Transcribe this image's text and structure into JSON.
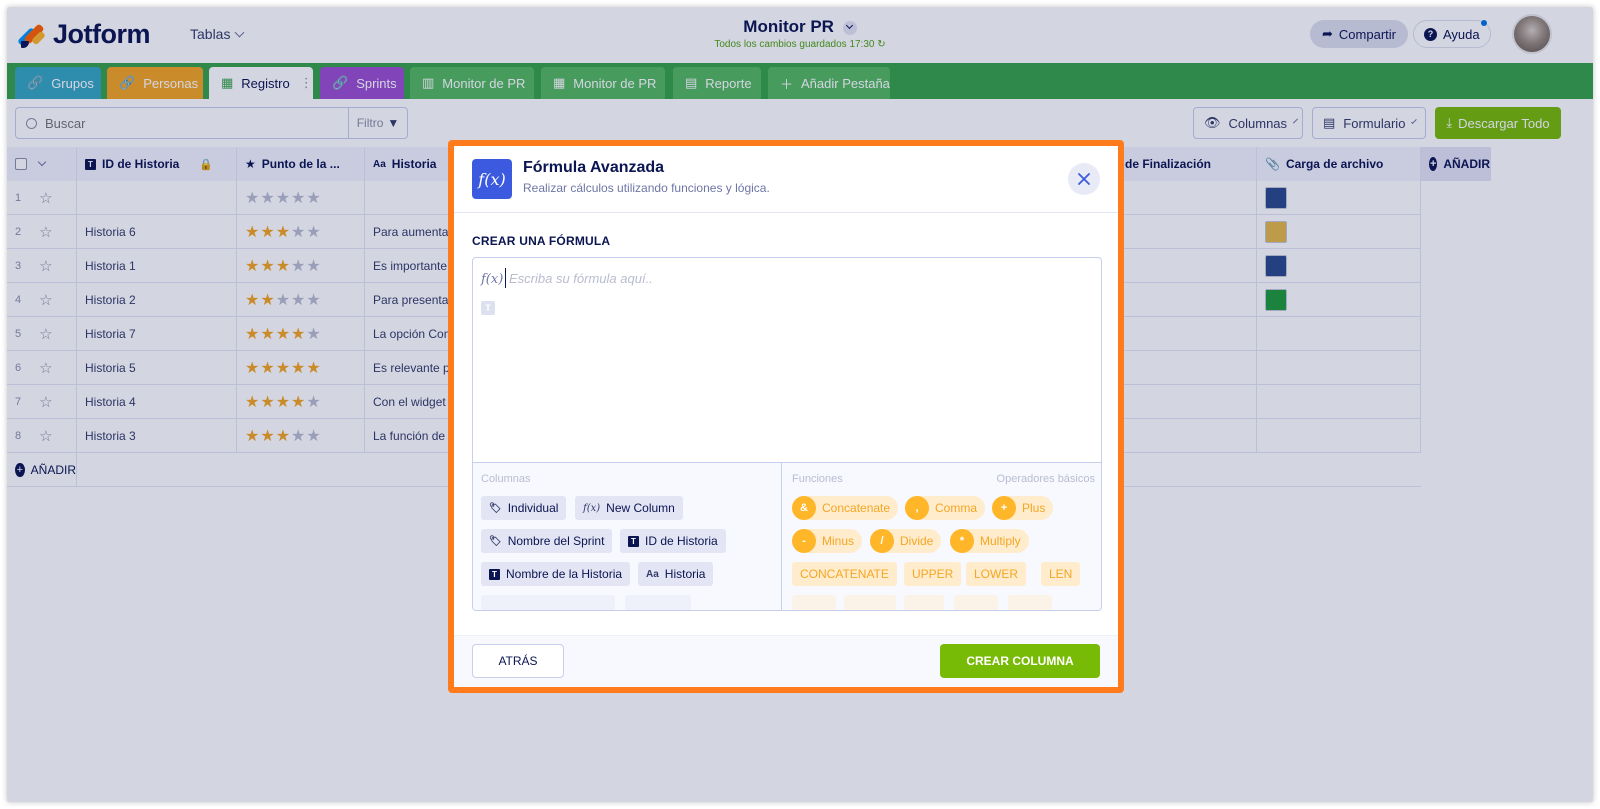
{
  "app": {
    "brand": "Jotform",
    "tables_menu": "Tablas",
    "title": "Monitor PR",
    "save_status": "Todos los cambios guardados 17:30",
    "share": "Compartir",
    "help": "Ayuda"
  },
  "tabs": [
    {
      "label": "Grupos",
      "color": "#36a6c0"
    },
    {
      "label": "Personas",
      "color": "#f5a623"
    },
    {
      "label": "Registro",
      "color": "#ffffff"
    },
    {
      "label": "Sprints",
      "color": "#9c4fd0"
    },
    {
      "label": "Monitor de PR",
      "color": "#55b960"
    },
    {
      "label": "Monitor de PR",
      "color": "#55b960"
    },
    {
      "label": "Reporte",
      "color": "#55b960"
    },
    {
      "label": "Añadir Pestaña",
      "color": "#55b960"
    }
  ],
  "toolbar": {
    "search_placeholder": "Buscar",
    "filter": "Filtro",
    "columns": "Columnas",
    "form": "Formulario",
    "download": "Descargar Todo"
  },
  "grid": {
    "headers": [
      "ID de Historia",
      "Punto de la ...",
      "Historia",
      "de Finalización",
      "Carga de archivo",
      "AÑADIR"
    ],
    "rows": [
      {
        "num": "1",
        "id": "",
        "stars": 0,
        "story": "",
        "swatch": "#2b4a8a"
      },
      {
        "num": "2",
        "id": "Historia 6",
        "stars": 3,
        "story": "Para aumentar",
        "swatch": "#e6b84a"
      },
      {
        "num": "3",
        "id": "Historia 1",
        "stars": 3,
        "story": "Es importante",
        "swatch": "#2b4a8a"
      },
      {
        "num": "4",
        "id": "Historia 2",
        "stars": 2,
        "story": "Para presentar",
        "swatch": "#1f9b3a"
      },
      {
        "num": "5",
        "id": "Historia 7",
        "stars": 4,
        "story": "La opción Com",
        "swatch": ""
      },
      {
        "num": "6",
        "id": "Historia 5",
        "stars": 5,
        "story": "Es relevante po",
        "swatch": ""
      },
      {
        "num": "7",
        "id": "Historia 4",
        "stars": 4,
        "story": "Con el widget d",
        "swatch": ""
      },
      {
        "num": "8",
        "id": "Historia 3",
        "stars": 3,
        "story": "La función de l",
        "swatch": ""
      }
    ],
    "add_row": "AÑADIR"
  },
  "modal": {
    "title": "Fórmula Avanzada",
    "subtitle": "Realizar cálculos utilizando funciones y lógica.",
    "section_label": "CREAR UNA FÓRMULA",
    "editor_placeholder": "Escriba su fórmula aquí..",
    "columns_label": "Columnas",
    "functions_label": "Funciones",
    "operators_label": "Operadores básicos",
    "column_chips": [
      {
        "icon": "tag-icon",
        "label": "Individual"
      },
      {
        "icon": "fx-icon",
        "label": "New Column"
      },
      {
        "icon": "tag-icon",
        "label": "Nombre del Sprint"
      },
      {
        "icon": "text-icon",
        "label": "ID de Historia"
      },
      {
        "icon": "text-icon",
        "label": "Nombre de la Historia"
      },
      {
        "icon": "aa-icon",
        "label": "Historia"
      }
    ],
    "operators": [
      {
        "symbol": "&",
        "label": "Concatenate"
      },
      {
        "symbol": ",",
        "label": "Comma"
      },
      {
        "symbol": "+",
        "label": "Plus"
      },
      {
        "symbol": "-",
        "label": "Minus"
      },
      {
        "symbol": "/",
        "label": "Divide"
      },
      {
        "symbol": "*",
        "label": "Multiply"
      }
    ],
    "functions": [
      "CONCATENATE",
      "UPPER",
      "LOWER",
      "LEN"
    ],
    "back": "ATRÁS",
    "create": "CREAR COLUMNA"
  }
}
